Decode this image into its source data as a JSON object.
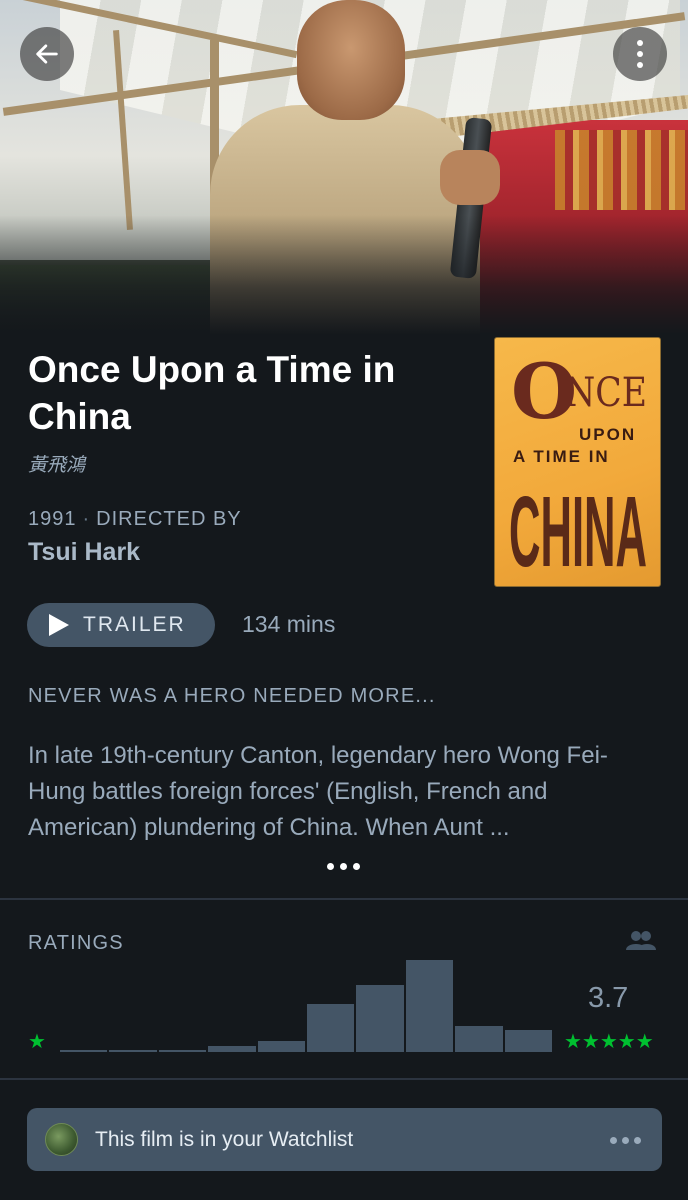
{
  "header": {
    "back_icon": "arrow-left-icon",
    "menu_icon": "more-vertical-icon"
  },
  "film": {
    "title": "Once Upon a Time in China",
    "original_title": "黃飛鴻",
    "year": "1991",
    "directed_by_label": "DIRECTED BY",
    "director": "Tsui Hark",
    "runtime": "134 mins",
    "tagline": "NEVER WAS A HERO NEEDED MORE...",
    "synopsis": "In late 19th-century Canton, legendary hero Wong Fei-Hung battles foreign forces' (English, French and American) plundering of China. When Aunt ...",
    "poster": {
      "line1": "ONCE",
      "line2": "UPON",
      "line3": "A TIME IN",
      "line4": "CHINA"
    }
  },
  "trailer": {
    "label": "TRAILER",
    "icon": "play-icon"
  },
  "ratings": {
    "title": "RATINGS",
    "average": "3.7",
    "low_star": "★",
    "high_stars": "★★★★★",
    "histogram_relative": [
      0.02,
      0.02,
      0.02,
      0.07,
      0.12,
      0.52,
      0.73,
      1.0,
      0.28,
      0.24
    ],
    "icon": "people-icon",
    "accent_color": "#00c030"
  },
  "watchlist": {
    "text": "This film is in your Watchlist",
    "icon": "more-horizontal-icon"
  },
  "colors": {
    "background": "#14181c",
    "muted_text": "#99aabb",
    "button_bg": "#445566"
  }
}
